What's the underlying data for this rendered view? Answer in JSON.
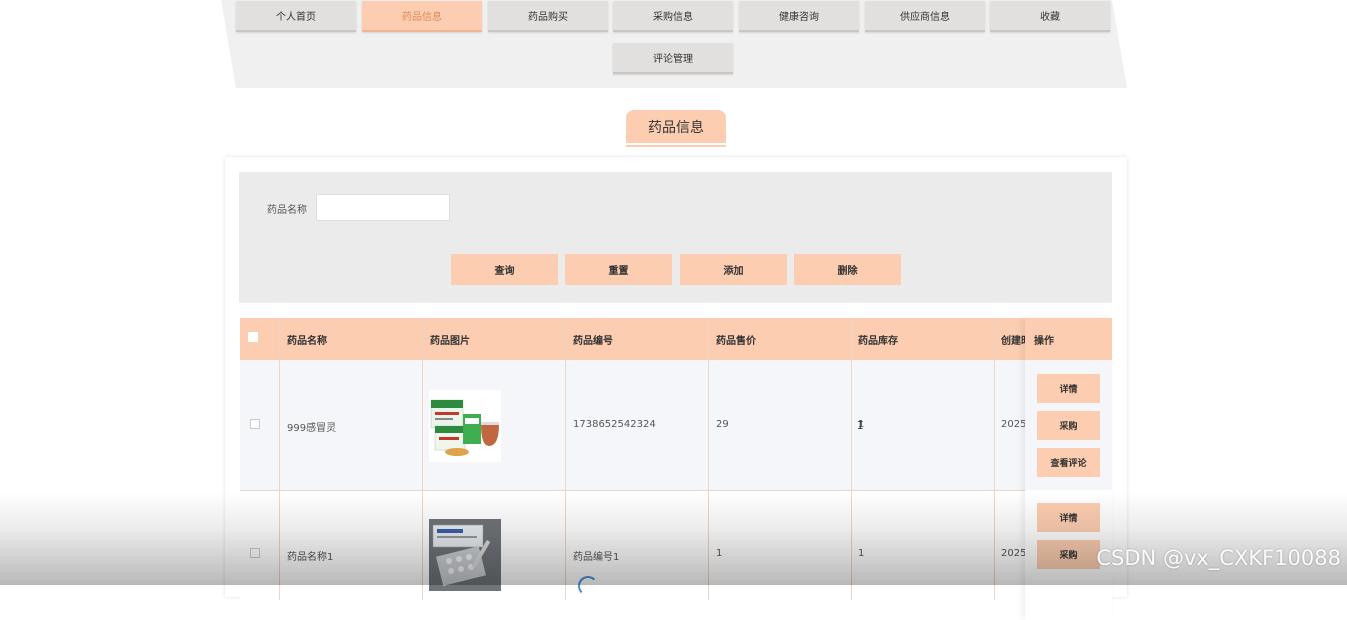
{
  "nav": {
    "items": [
      {
        "label": "个人首页",
        "active": false
      },
      {
        "label": "药品信息",
        "active": true
      },
      {
        "label": "药品购买",
        "active": false
      },
      {
        "label": "采购信息",
        "active": false
      },
      {
        "label": "健康咨询",
        "active": false
      },
      {
        "label": "供应商信息",
        "active": false
      },
      {
        "label": "收藏",
        "active": false
      },
      {
        "label": "评论管理",
        "active": false
      }
    ]
  },
  "page": {
    "title": "药品信息"
  },
  "search": {
    "label": "药品名称",
    "value": "",
    "buttons": {
      "query": "查询",
      "reset": "重置",
      "add": "添加",
      "delete": "删除"
    }
  },
  "table": {
    "headers": [
      "药品名称",
      "药品图片",
      "药品编号",
      "药品售价",
      "药品库存",
      "创建时",
      "操作"
    ],
    "rows": [
      {
        "name": "999感冒灵",
        "image": "medicine-box-green-image",
        "code": "1738652542324",
        "price": "29",
        "stock": "1",
        "created": "2025-"
      },
      {
        "name": "药品名称1",
        "image": "medicine-box-blister-image",
        "code": "药品编号1",
        "price": "1",
        "stock": "1",
        "created": "2025-"
      }
    ],
    "ops": {
      "detail": "详情",
      "purchase": "采购",
      "view_comments": "查看评论"
    }
  },
  "watermark": "CSDN @vx_CXKF10088",
  "colors": {
    "accent": "#fccdb0",
    "nav_bg": "#f0f0f0",
    "row_alt": "#f5f6fa"
  }
}
